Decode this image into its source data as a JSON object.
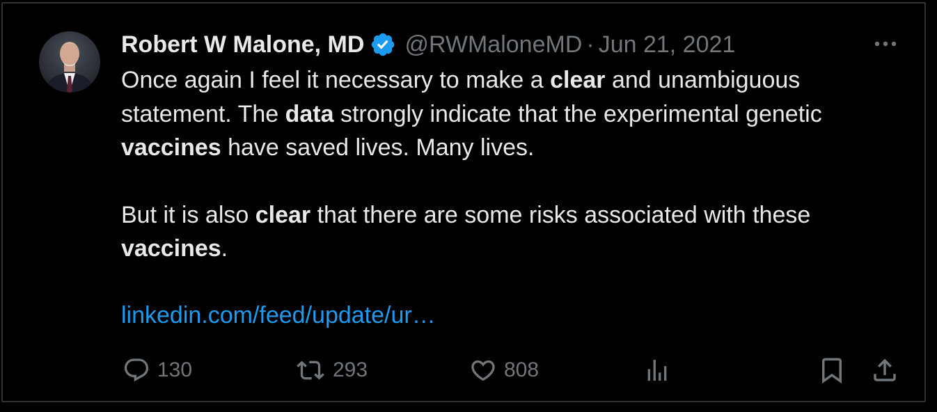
{
  "author": {
    "display_name": "Robert W Malone, MD",
    "handle": "@RWMaloneMD",
    "separator": "·",
    "date": "Jun 21, 2021",
    "verified": true
  },
  "tweet": {
    "p1": {
      "t1": "Once again I feel it necessary to make a ",
      "b1": "clear",
      "t2": " and unambiguous statement. The ",
      "b2": "data",
      "t3": " strongly indicate that the experimental genetic ",
      "b3": "vaccines",
      "t4": " have saved lives. Many lives."
    },
    "p2": {
      "t1": "But it is also ",
      "b1": "clear",
      "t2": " that there are some risks associated with these ",
      "b2": "vaccines",
      "t3": "."
    },
    "link": "linkedin.com/feed/update/ur…"
  },
  "actions": {
    "replies": "130",
    "retweets": "293",
    "likes": "808"
  },
  "colors": {
    "background": "#000000",
    "text": "#e7e9ea",
    "muted": "#71767b",
    "link": "#1d9bf0",
    "verified": "#1d9bf0",
    "border": "#2f3336"
  },
  "icons": [
    "avatar",
    "verified-badge-icon",
    "more-icon",
    "reply-icon",
    "retweet-icon",
    "like-icon",
    "views-icon",
    "bookmark-icon",
    "share-icon"
  ]
}
